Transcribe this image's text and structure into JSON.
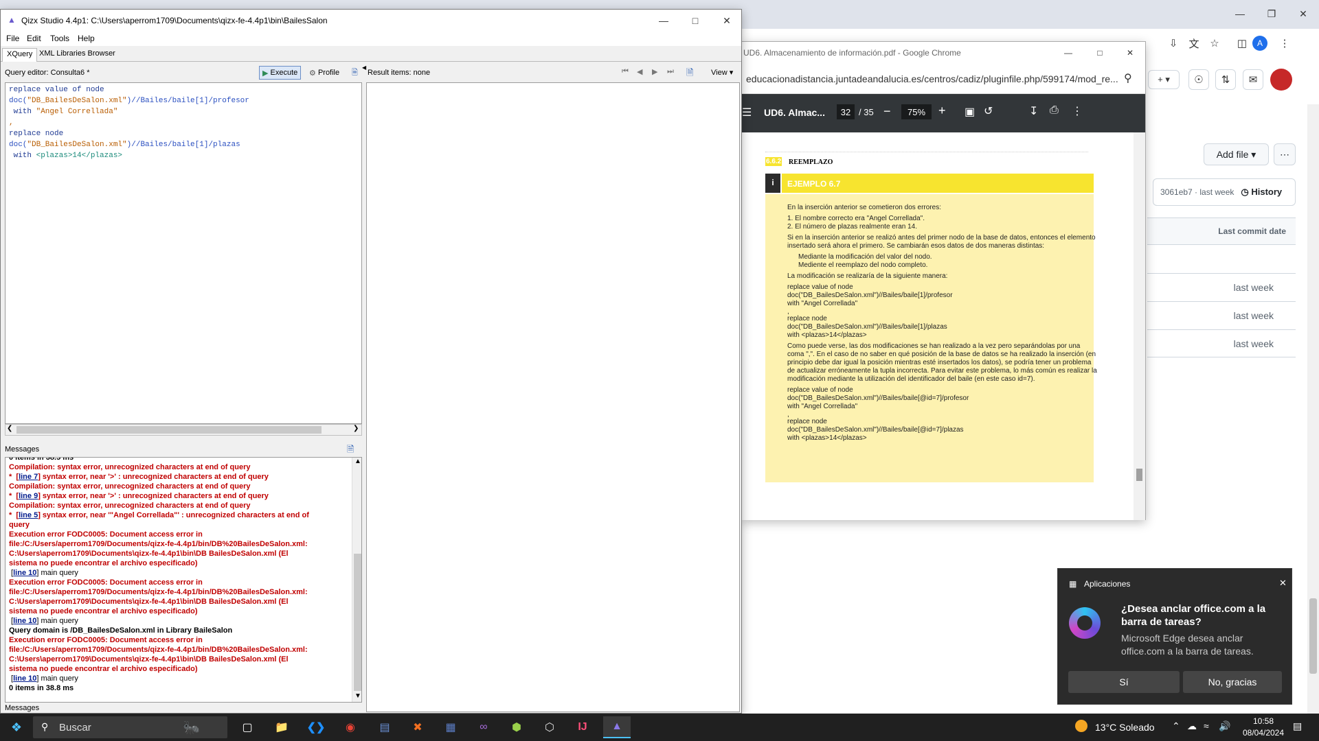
{
  "chrome_back": {
    "addfile_label": "Add file",
    "commit_text": "3061eb7 · last week",
    "history_label": "History",
    "last_commit_header": "Last commit date",
    "rows": [
      "last week",
      "last week",
      "last week"
    ],
    "avatar_letter": "A"
  },
  "pdf_window": {
    "title": "UD6. Almacenamiento de información.pdf - Google Chrome",
    "url": "educacionadistancia.juntadeandalucia.es/centros/cadiz/pluginfile.php/599174/mod_re...",
    "doc_title": "UD6. Almac...",
    "page_current": "32",
    "page_total": "/ 35",
    "zoom": "75%",
    "content": {
      "section_num": "6.6.2",
      "section_title": "REEMPLAZO",
      "example_title": "EJEMPLO 6.7",
      "p1": "En la inserción anterior se cometieron dos errores:",
      "li1": "1.  El nombre correcto era \"Angel Correllada\".",
      "li2": "2.  El número de plazas realmente eran 14.",
      "p2a": "Si en la inserción anterior se realizó antes del primer nodo de la base de datos, entonces el elemento",
      "p2b": "insertado será ahora el primero. Se cambiarán esos datos de dos maneras distintas:",
      "b1": "Mediante la modificación del valor del nodo.",
      "b2": "Mediente el reemplazo del nodo completo.",
      "p3": "La modificación se realizaría de la siguiente manera:",
      "c1": "replace value of node",
      "c2": "doc(\"DB_BailesDeSalon.xml\")//Bailes/baile[1]/profesor",
      "c3": "with \"Angel Correllada\"",
      "c4": ",",
      "c5": "replace node",
      "c6": "doc(\"DB_BailesDeSalon.xml\")//Bailes/baile[1]/plazas",
      "c7": "with <plazas>14</plazas>",
      "p4a": "Como puede verse, las dos modificaciones se han realizado a la vez pero separándolas por una",
      "p4b": "coma \",\". En el caso de no saber en qué posición de la base de datos se ha realizado la inserción (en",
      "p4c": "principio debe dar igual la posición mientras esté insertados los datos), se podría tener un problema",
      "p4d": "de actualizar erróneamente la tupla incorrecta. Para evitar este problema, lo más común es realizar la",
      "p4e": "modificación mediante la utilización del identificador del baile (en este caso id=7).",
      "d1": "replace value of node",
      "d2": "doc(\"DB_BailesDeSalon.xml\")//Bailes/baile[@id=7]/profesor",
      "d3": "with \"Angel Correllada\"",
      "d4": ",",
      "d5": "replace node",
      "d6": "doc(\"DB_BailesDeSalon.xml\")//Bailes/baile[@id=7]/plazas",
      "d7": "with <plazas>14</plazas>"
    }
  },
  "qizx": {
    "title": "Qizx Studio 4.4p1: C:\\Users\\aperrom1709\\Documents\\qizx-fe-4.4p1\\bin\\BailesSalon",
    "menu": [
      "File",
      "Edit",
      "Tools",
      "Help"
    ],
    "tabs": [
      "XQuery",
      "XML Libraries Browser"
    ],
    "editor_label": "Query editor: Consulta6 *",
    "execute_label": "Execute",
    "profile_label": "Profile",
    "result_label": "Result items: none",
    "view_label": "View",
    "code": {
      "l1": "replace value of node",
      "l2_fn": "doc(",
      "l2_str": "\"DB_BailesDeSalon.xml\"",
      "l2_path": ")//Bailes/baile[1]/profesor",
      "l3_kw": " with ",
      "l3_str": "\"Angel Correllada\"",
      "l4": ",",
      "l5": "replace node",
      "l6_fn": "doc(",
      "l6_str": "\"DB_BailesDeSalon.xml\"",
      "l6_path": ")//Bailes/baile[1]/plazas",
      "l7_kw": " with ",
      "l7_tag": "<plazas>14</plazas>"
    },
    "messages_label": "Messages",
    "messages": {
      "m0": "0 items in 38.5 ms",
      "m1": "Compilation: syntax error, unrecognized characters at end of query",
      "m2_link": "line 7",
      "m2_text": " syntax error, near '>' : unrecognized characters at end of query",
      "m3": "Compilation: syntax error, unrecognized characters at end of query",
      "m4_link": "line 9",
      "m4_text": " syntax error, near '>' : unrecognized characters at end of query",
      "m5": "Compilation: syntax error, unrecognized characters at end of query",
      "m6_link": "line 5",
      "m6_text": " syntax error, near '\"Angel Correllada\"' : unrecognized characters at end of",
      "m6b": "query",
      "e1a": "Execution error FODC0005: Document access error in",
      "e1b": "file:/C:/Users/aperrom1709/Documents/qizx-fe-4.4p1/bin/DB%20BailesDeSalon.xml:",
      "e1c": "C:\\Users\\aperrom1709\\Documents\\qizx-fe-4.4p1\\bin\\DB BailesDeSalon.xml (El",
      "e1d": "sistema no puede encontrar el archivo especificado)",
      "l10a_link": "line 10",
      "l10a_text": " main query",
      "e2a": "Execution error FODC0005: Document access error in",
      "e2b": "file:/C:/Users/aperrom1709/Documents/qizx-fe-4.4p1/bin/DB%20BailesDeSalon.xml:",
      "e2c": "C:\\Users\\aperrom1709\\Documents\\qizx-fe-4.4p1\\bin\\DB BailesDeSalon.xml (El",
      "e2d": "sistema no puede encontrar el archivo especificado)",
      "l10b_link": "line 10",
      "l10b_text": " main query",
      "dom": "Query domain is /DB_BailesDeSalon.xml in Library BaileSalon",
      "e3a": "Execution error FODC0005: Document access error in",
      "e3b": "file:/C:/Users/aperrom1709/Documents/qizx-fe-4.4p1/bin/DB%20BailesDeSalon.xml:",
      "e3c": "C:\\Users\\aperrom1709\\Documents\\qizx-fe-4.4p1\\bin\\DB BailesDeSalon.xml (El",
      "e3d": "sistema no puede encontrar el archivo especificado)",
      "l10c_link": "line 10",
      "l10c_text": " main query",
      "last": "0 items in 38.8 ms"
    },
    "bottom_tab": "Messages"
  },
  "notification": {
    "app": "Aplicaciones",
    "title": "¿Desea anclar office.com a la barra de tareas?",
    "body": "Microsoft Edge desea anclar office.com a la barra de tareas.",
    "yes": "Sí",
    "no": "No, gracias"
  },
  "taskbar": {
    "search": "Buscar",
    "weather": "13°C  Soleado",
    "time": "10:58",
    "date": "08/04/2024"
  }
}
